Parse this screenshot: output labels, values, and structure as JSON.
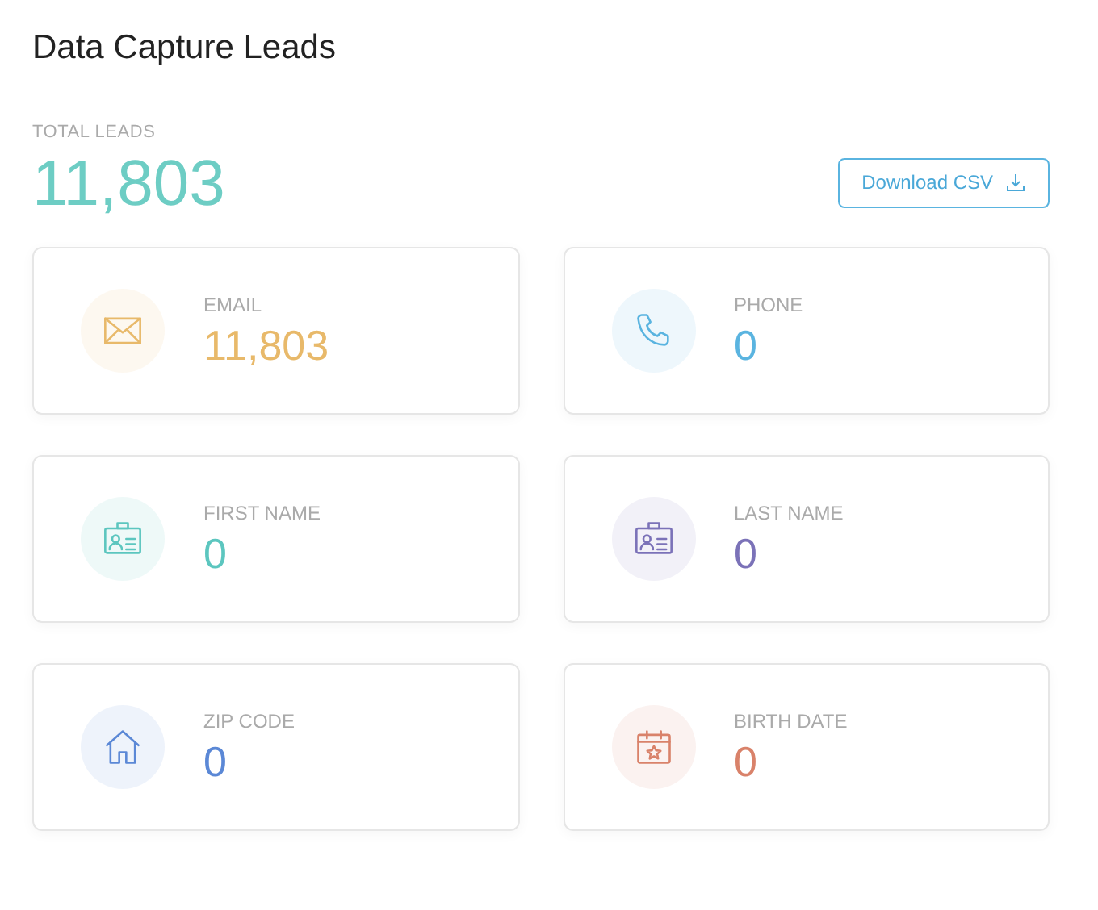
{
  "title": "Data Capture Leads",
  "total": {
    "label": "TOTAL LEADS",
    "value": "11,803"
  },
  "download_button": {
    "label": "Download CSV"
  },
  "cards": [
    {
      "kind": "email",
      "label": "EMAIL",
      "value": "11,803",
      "color": "#e8b96a"
    },
    {
      "kind": "phone",
      "label": "PHONE",
      "value": "0",
      "color": "#5ab4e0"
    },
    {
      "kind": "id",
      "label": "FIRST NAME",
      "value": "0",
      "color": "#5cc6bf"
    },
    {
      "kind": "id",
      "label": "LAST NAME",
      "value": "0",
      "color": "#7b72b8"
    },
    {
      "kind": "home",
      "label": "ZIP CODE",
      "value": "0",
      "color": "#5b88d6"
    },
    {
      "kind": "calendar",
      "label": "BIRTH DATE",
      "value": "0",
      "color": "#d9826a"
    }
  ]
}
